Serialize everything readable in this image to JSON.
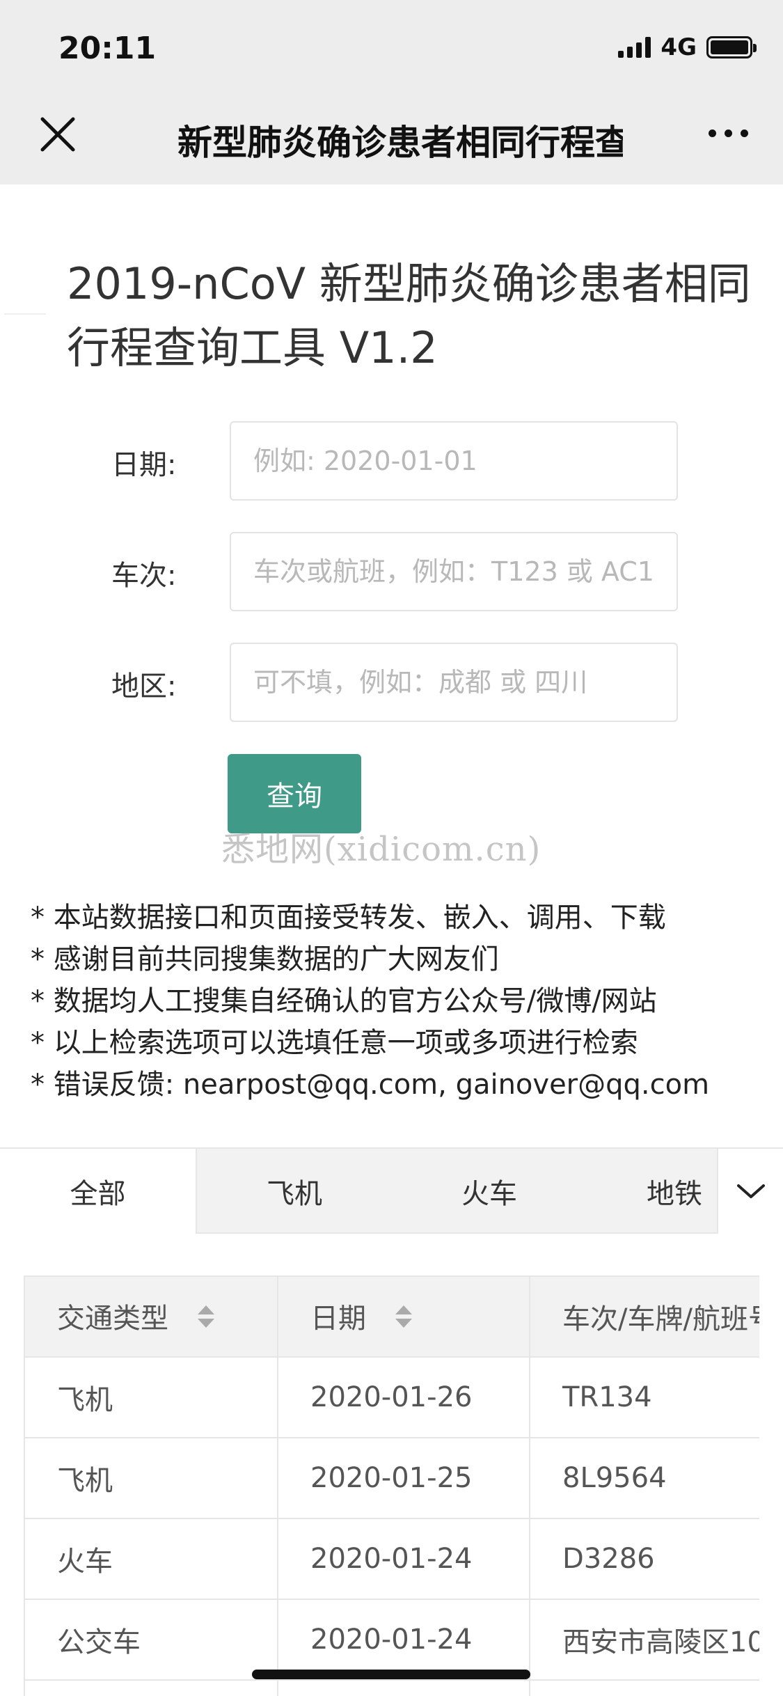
{
  "status_bar": {
    "time": "20:11",
    "network": "4G"
  },
  "nav": {
    "title": "新型肺炎确诊患者相同行程查询工具"
  },
  "page": {
    "title": "2019-nCoV 新型肺炎确诊患者相同行程查询工具 V1.2"
  },
  "form": {
    "date_label": "日期:",
    "date_placeholder": "例如: 2020-01-01",
    "train_label": "车次:",
    "train_placeholder": "车次或航班，例如：T123 或 AC1",
    "region_label": "地区:",
    "region_placeholder": "可不填，例如：成都 或 四川",
    "query_button": "查询"
  },
  "watermark": "悉地网(xidicom.cn)",
  "notes": [
    "* 本站数据接口和页面接受转发、嵌入、调用、下载",
    "* 感谢目前共同搜集数据的广大网友们",
    "* 数据均人工搜集自经确认的官方公众号/微博/网站",
    "* 以上检索选项可以选填任意一项或多项进行检索",
    "* 错误反馈: nearpost@qq.com, gainover@qq.com"
  ],
  "tabs": [
    "全部",
    "飞机",
    "火车",
    "地铁"
  ],
  "table": {
    "headers": [
      "交通类型",
      "日期",
      "车次/车牌/航班号"
    ],
    "rows": [
      [
        "飞机",
        "2020-01-26",
        "TR134"
      ],
      [
        "飞机",
        "2020-01-25",
        "8L9564"
      ],
      [
        "火车",
        "2020-01-24",
        "D3286"
      ],
      [
        "公交车",
        "2020-01-24",
        "西安市高陵区10"
      ],
      [
        "",
        "",
        ""
      ]
    ]
  },
  "colors": {
    "accent": "#3f9a88",
    "nav_bg": "#ededed"
  }
}
